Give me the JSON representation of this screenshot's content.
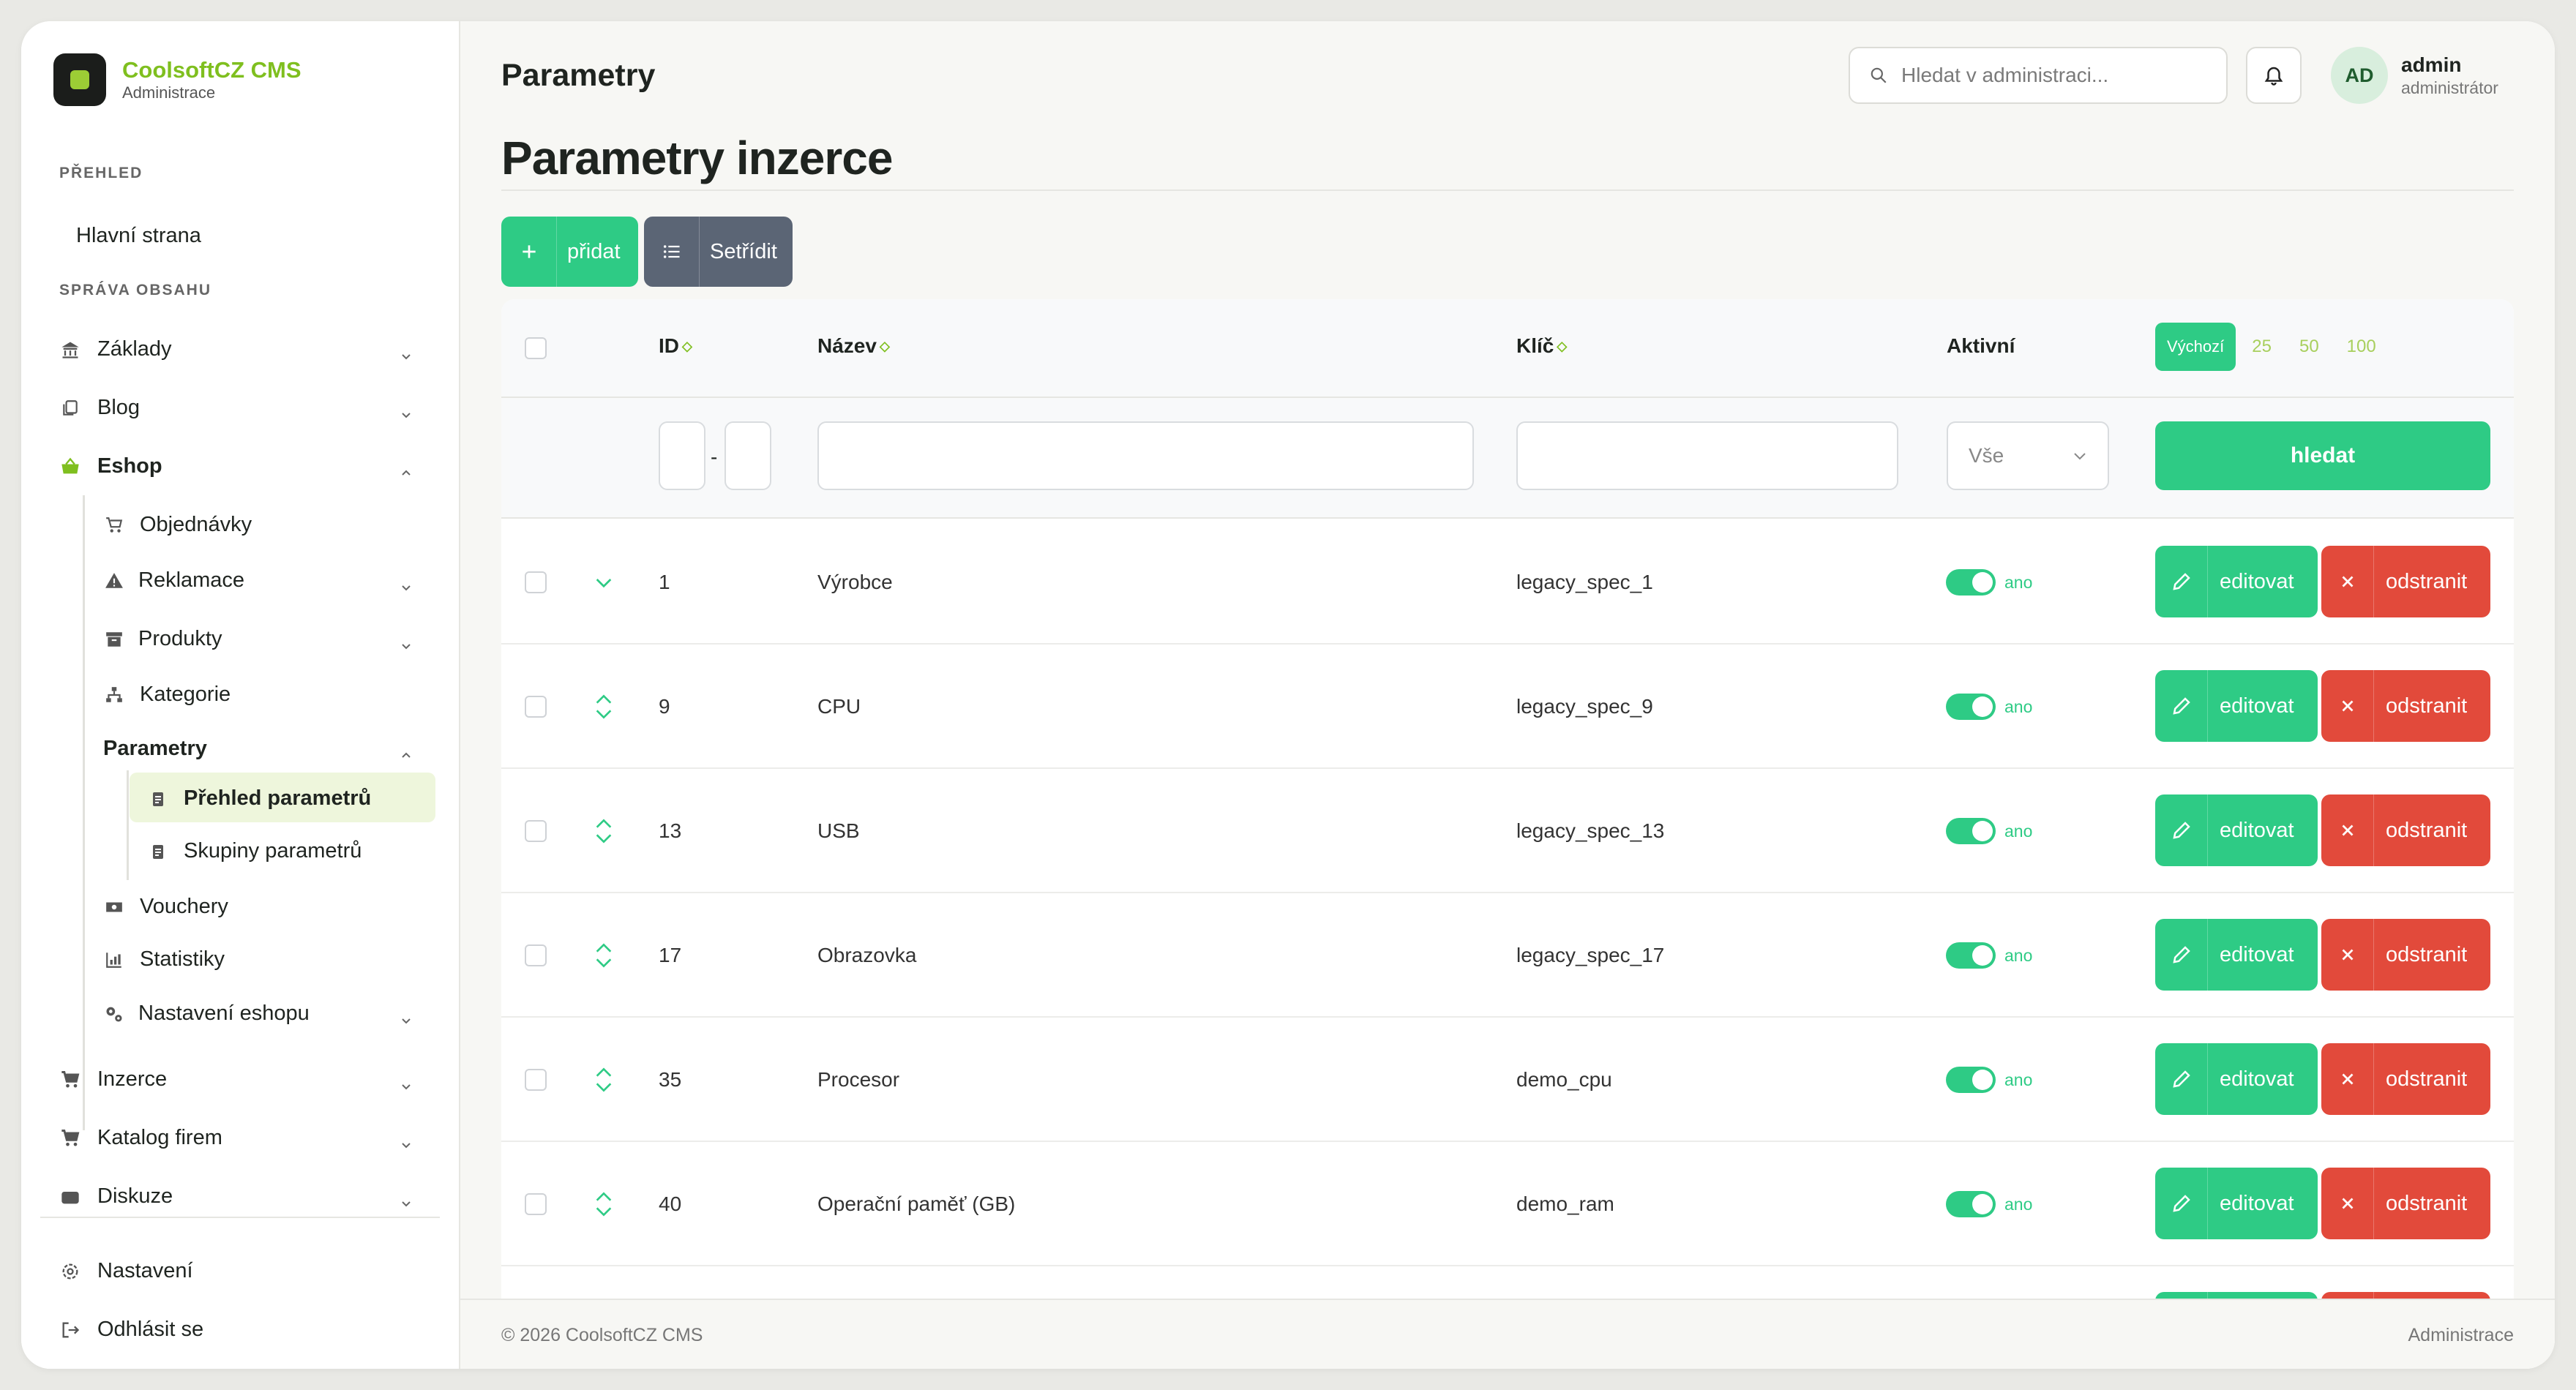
{
  "brand": {
    "name": "CoolsoftCZ CMS",
    "sub": "Administrace"
  },
  "sidebar": {
    "sections": [
      "PŘEHLED",
      "SPRÁVA OBSAHU"
    ],
    "home": "Hlavní strana",
    "items": [
      "Základy",
      "Blog",
      "Eshop",
      "Objednávky",
      "Reklamace",
      "Produkty",
      "Kategorie",
      "Parametry",
      "Přehled parametrů",
      "Skupiny parametrů",
      "Vouchery",
      "Statistiky",
      "Nastavení eshopu",
      "Inzerce",
      "Katalog firem",
      "Diskuze"
    ],
    "bottom": [
      "Nastavení",
      "Odhlásit se"
    ]
  },
  "header": {
    "title": "Parametry",
    "search_placeholder": "Hledat v administraci...",
    "avatar": "AD",
    "user_name": "admin",
    "user_role": "administrátor"
  },
  "page": {
    "heading": "Parametry inzerce",
    "add_label": "přidat",
    "sort_label": "Setřídit"
  },
  "table": {
    "headers": {
      "id": "ID",
      "name": "Název",
      "key": "Klíč",
      "active": "Aktivní"
    },
    "per_page": [
      "Výchozí",
      "25",
      "50",
      "100"
    ],
    "filter": {
      "dash": "-",
      "select_value": "Vše",
      "search_label": "hledat"
    },
    "rows": [
      {
        "id": "1",
        "name": "Výrobce",
        "key": "legacy_spec_1",
        "active": "ano"
      },
      {
        "id": "9",
        "name": "CPU",
        "key": "legacy_spec_9",
        "active": "ano"
      },
      {
        "id": "13",
        "name": "USB",
        "key": "legacy_spec_13",
        "active": "ano"
      },
      {
        "id": "17",
        "name": "Obrazovka",
        "key": "legacy_spec_17",
        "active": "ano"
      },
      {
        "id": "35",
        "name": "Procesor",
        "key": "demo_cpu",
        "active": "ano"
      },
      {
        "id": "40",
        "name": "Operační paměť (GB)",
        "key": "demo_ram",
        "active": "ano"
      }
    ],
    "edit_label": "editovat",
    "delete_label": "odstranit"
  },
  "footer": {
    "left": "© 2026 CoolsoftCZ CMS",
    "right": "Administrace"
  },
  "colors": {
    "accent": "#2ecb85",
    "danger": "#e24a3b",
    "brand": "#7fbf1f",
    "neutral_button": "#5b6575"
  }
}
